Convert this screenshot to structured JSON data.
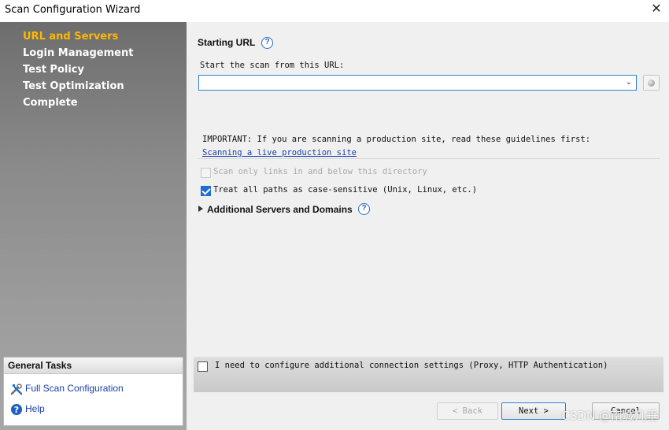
{
  "window": {
    "title": "Scan Configuration Wizard",
    "close_glyph": "✕"
  },
  "sidebar": {
    "items": [
      {
        "label": "URL and Servers",
        "active": true
      },
      {
        "label": "Login Management",
        "active": false
      },
      {
        "label": "Test Policy",
        "active": false
      },
      {
        "label": "Test Optimization",
        "active": false
      },
      {
        "label": "Complete",
        "active": false
      }
    ],
    "general_tasks": {
      "title": "General Tasks",
      "items": [
        {
          "label": "Full Scan Configuration",
          "icon": "tools-icon"
        },
        {
          "label": "Help",
          "icon": "help-icon"
        }
      ]
    }
  },
  "main": {
    "section_title": "Starting URL",
    "start_label": "Start the scan from this URL:",
    "url_value": "",
    "important_text": "IMPORTANT: If you are scanning a production site, read these guidelines first:",
    "production_link": "Scanning a live production site",
    "scan_only_label": "Scan only links in and below this directory",
    "scan_only_checked": false,
    "scan_only_enabled": false,
    "case_sensitive_label": "Treat all paths as case-sensitive (Unix, Linux, etc.)",
    "case_sensitive_checked": true,
    "additional_servers_label": "Additional Servers and Domains",
    "connection_settings_label": "I need to configure additional connection settings (Proxy, HTTP Authentication)",
    "connection_settings_checked": false
  },
  "buttons": {
    "back": "< Back",
    "next": "Next >",
    "cancel": "Cancel"
  },
  "watermark": "CSDN @南城几垂",
  "colors": {
    "active_nav": "#ffb800",
    "link": "#1a3fa8",
    "accent": "#1e6fd0"
  }
}
